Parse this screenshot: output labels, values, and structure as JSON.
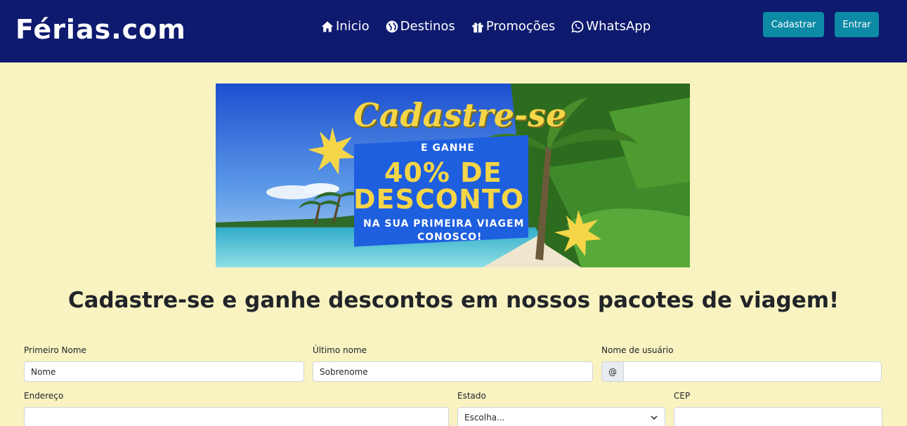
{
  "brand": "Férias.com",
  "nav": {
    "items": [
      {
        "label": "Inicio",
        "icon": "home-icon"
      },
      {
        "label": "Destinos",
        "icon": "globe-icon"
      },
      {
        "label": "Promoções",
        "icon": "gift-icon"
      },
      {
        "label": "WhatsApp",
        "icon": "whatsapp-icon"
      }
    ],
    "cadastrar": "Cadastrar",
    "entrar": "Entrar"
  },
  "banner": {
    "title": "Cadastre-se",
    "sub": "E GANHE",
    "pct": "40% DE",
    "desc": "DESCONTO",
    "line1": "NA SUA PRIMEIRA VIAGEM",
    "line2": "CONOSCO!"
  },
  "headline": "Cadastre-se e ganhe descontos em nossos pacotes de viagem!",
  "form": {
    "first_name_label": "Primeiro Nome",
    "first_name_placeholder": "Nome",
    "last_name_label": "Último nome",
    "last_name_placeholder": "Sobrenome",
    "username_label": "Nome de usuário",
    "username_prefix": "@",
    "address_label": "Endereço",
    "state_label": "Estado",
    "state_selected": "Escolha...",
    "cep_label": "CEP"
  },
  "colors": {
    "navbar": "#0d1a6e",
    "button": "#0d8aa6",
    "page_bg": "#f8f3c1",
    "banner_accent": "#f5d548",
    "banner_box": "#1e5fe0"
  }
}
